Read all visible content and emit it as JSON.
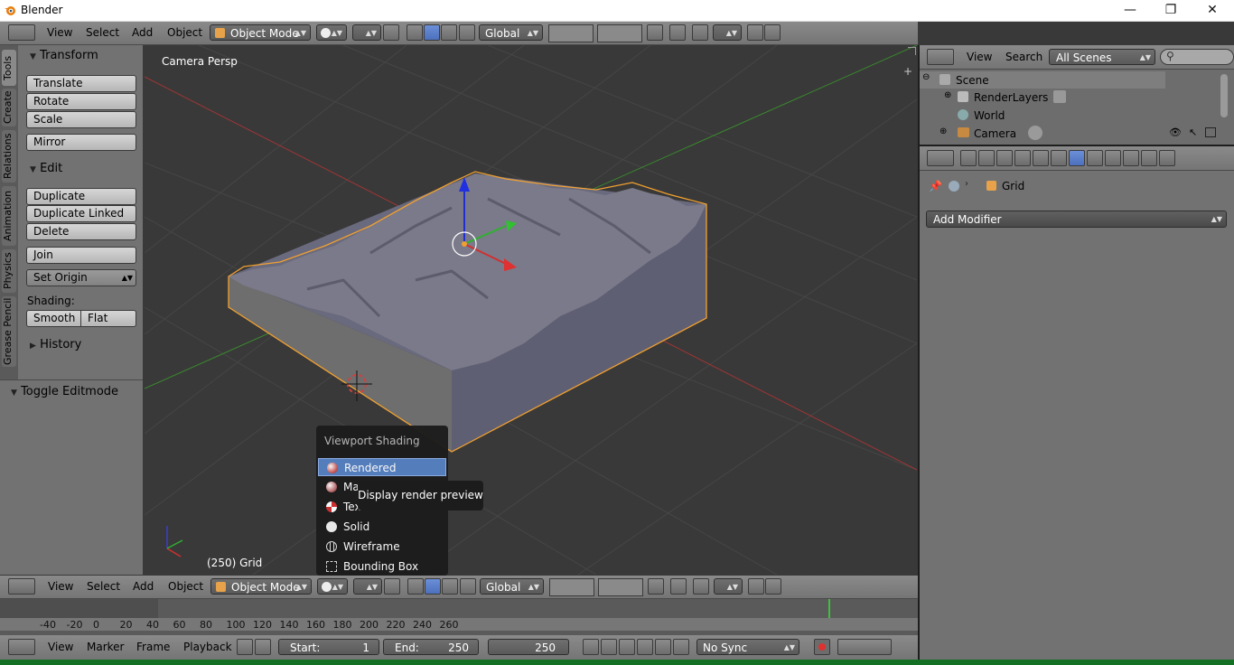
{
  "window": {
    "title": "Blender",
    "controls": [
      "—",
      "❐",
      "✕"
    ]
  },
  "top_header": {
    "menus": [
      "View",
      "Select",
      "Add",
      "Object"
    ],
    "mode": "Object Mode",
    "orientation": "Global"
  },
  "tool_tabs": [
    "Tools",
    "Create",
    "Relations",
    "Animation",
    "Physics",
    "Grease Pencil"
  ],
  "tool_shelf": {
    "transform": {
      "title": "Transform",
      "buttons": [
        "Translate",
        "Rotate",
        "Scale",
        "Mirror"
      ]
    },
    "edit": {
      "title": "Edit",
      "buttons": [
        "Duplicate",
        "Duplicate Linked",
        "Delete",
        "Join"
      ],
      "set_origin": "Set Origin"
    },
    "shading": {
      "label": "Shading:",
      "smooth": "Smooth",
      "flat": "Flat"
    },
    "history": "History",
    "toggle_editmode": "Toggle Editmode"
  },
  "viewport": {
    "view_label": "Camera Persp",
    "object_label": "(250) Grid"
  },
  "shading_menu": {
    "title": "Viewport Shading",
    "items": [
      "Rendered",
      "Material",
      "Texture",
      "Solid",
      "Wireframe",
      "Bounding Box"
    ],
    "selected": "Rendered",
    "tooltip": "Display render preview"
  },
  "bottom_header": {
    "menus": [
      "View",
      "Select",
      "Add",
      "Object"
    ],
    "mode": "Object Mode",
    "orientation": "Global"
  },
  "timeline": {
    "ticks": [
      "-40",
      "-20",
      "0",
      "20",
      "40",
      "60",
      "80",
      "100",
      "120",
      "140",
      "160",
      "180",
      "200",
      "220",
      "240",
      "260"
    ],
    "current_frame_marker": 250,
    "menus": [
      "View",
      "Marker",
      "Frame",
      "Playback"
    ],
    "start_label": "Start:",
    "start": "1",
    "end_label": "End:",
    "end": "250",
    "current": "250",
    "sync": "No Sync"
  },
  "outliner": {
    "menus": [
      "View",
      "Search"
    ],
    "scenes": "All Scenes",
    "tree": [
      {
        "label": "Scene"
      },
      {
        "label": "RenderLayers"
      },
      {
        "label": "World"
      },
      {
        "label": "Camera"
      }
    ]
  },
  "properties": {
    "object_name": "Grid",
    "add_modifier": "Add Modifier"
  },
  "colors": {
    "selection_outline": "#f0a030",
    "menu_highlight": "#5680c2",
    "x_axis": "#b03030",
    "y_axis": "#409030"
  }
}
